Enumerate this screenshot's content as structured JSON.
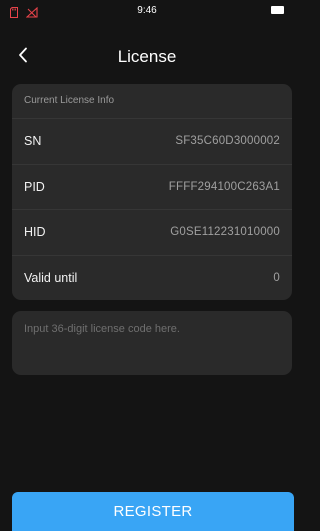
{
  "status_bar": {
    "time": "9:46",
    "icons": [
      "sd-card-icon",
      "no-signal-icon",
      "battery-icon"
    ],
    "icon_color": "#e8434a"
  },
  "header": {
    "back_icon": "chevron-left-icon",
    "title": "License"
  },
  "license_info": {
    "section_title": "Current License Info",
    "rows": [
      {
        "label": "SN",
        "value": "SF35C60D3000002"
      },
      {
        "label": "PID",
        "value": "FFFF294100C263A1"
      },
      {
        "label": "HID",
        "value": "G0SE112231010000"
      },
      {
        "label": "Valid until",
        "value": "0"
      }
    ]
  },
  "license_input": {
    "placeholder": "Input 36-digit license code here.",
    "value": ""
  },
  "register_button": {
    "label": "REGISTER",
    "color": "#39a5f5"
  }
}
